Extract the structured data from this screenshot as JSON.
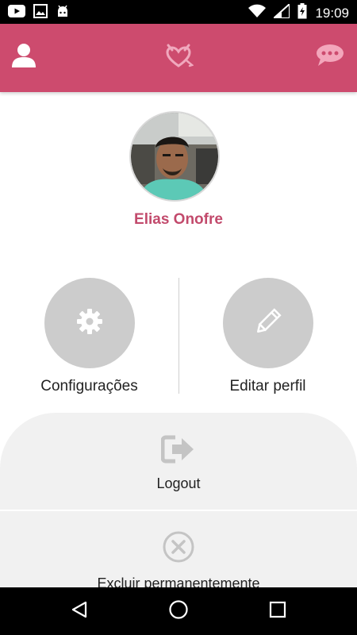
{
  "status_bar": {
    "time": "19:09",
    "icons": [
      "youtube-icon",
      "image-icon",
      "android-icon",
      "wifi-icon",
      "signal-icon",
      "battery-charging-icon"
    ]
  },
  "app_bar": {
    "left_icon": "user-icon",
    "center_icon": "devil-heart-logo-icon",
    "right_icon": "chat-bubble-icon",
    "color": "#cd4b6e"
  },
  "profile": {
    "name": "Elias Onofre",
    "name_color": "#c24a6c"
  },
  "actions": [
    {
      "label": "Configurações",
      "icon": "gear-icon"
    },
    {
      "label": "Editar perfil",
      "icon": "pencil-icon"
    }
  ],
  "panel": {
    "logout": {
      "label": "Logout",
      "icon": "sign-out-icon"
    },
    "delete": {
      "label": "Excluir permanentemente",
      "icon": "close-circle-icon"
    }
  },
  "nav_bar": {
    "icons": [
      "back-icon",
      "home-icon",
      "recent-apps-icon"
    ]
  }
}
